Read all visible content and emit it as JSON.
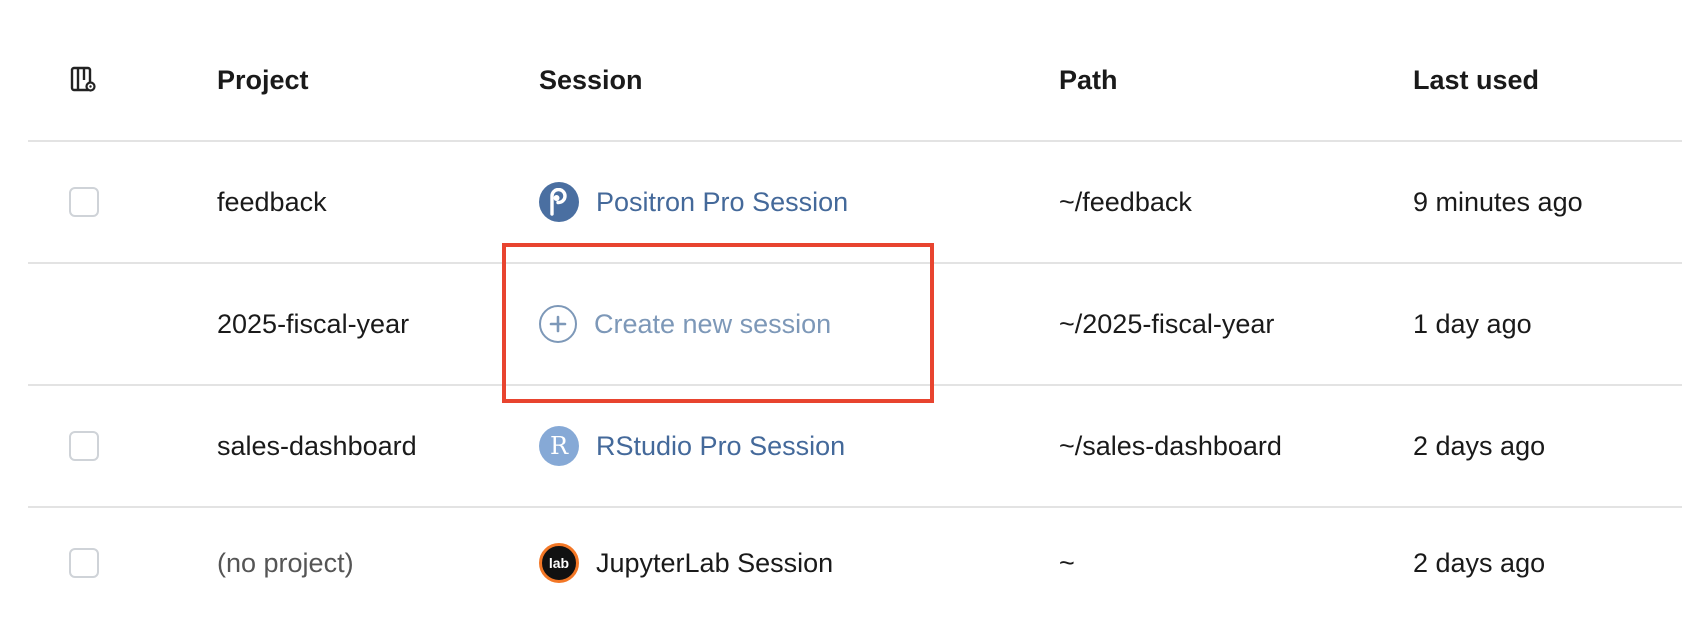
{
  "header": {
    "columns": {
      "settings_icon": "column-settings-icon",
      "project": "Project",
      "session": "Session",
      "path": "Path",
      "last_used": "Last used"
    }
  },
  "rows": [
    {
      "has_checkbox": true,
      "project": "feedback",
      "session": "Positron Pro Session",
      "session_icon": "positron-icon",
      "path": "~/feedback",
      "last_used": "9 minutes ago"
    },
    {
      "has_checkbox": false,
      "project": "2025-fiscal-year",
      "session": "Create new session",
      "session_icon": "plus-circle-icon",
      "path": "~/2025-fiscal-year",
      "last_used": "1 day ago"
    },
    {
      "has_checkbox": true,
      "project": "sales-dashboard",
      "session": "RStudio Pro Session",
      "session_icon": "rstudio-icon",
      "session_icon_letter": "R",
      "path": "~/sales-dashboard",
      "last_used": "2 days ago"
    },
    {
      "has_checkbox": true,
      "project": "(no project)",
      "session": "JupyterLab Session",
      "session_icon": "jupyterlab-icon",
      "session_icon_text": "lab",
      "path": "~",
      "last_used": "2 days ago"
    }
  ],
  "colors": {
    "link": "#44699a",
    "create_link": "#7d98b8",
    "highlight_border": "#e8442f",
    "divider": "#e3e3e3"
  }
}
